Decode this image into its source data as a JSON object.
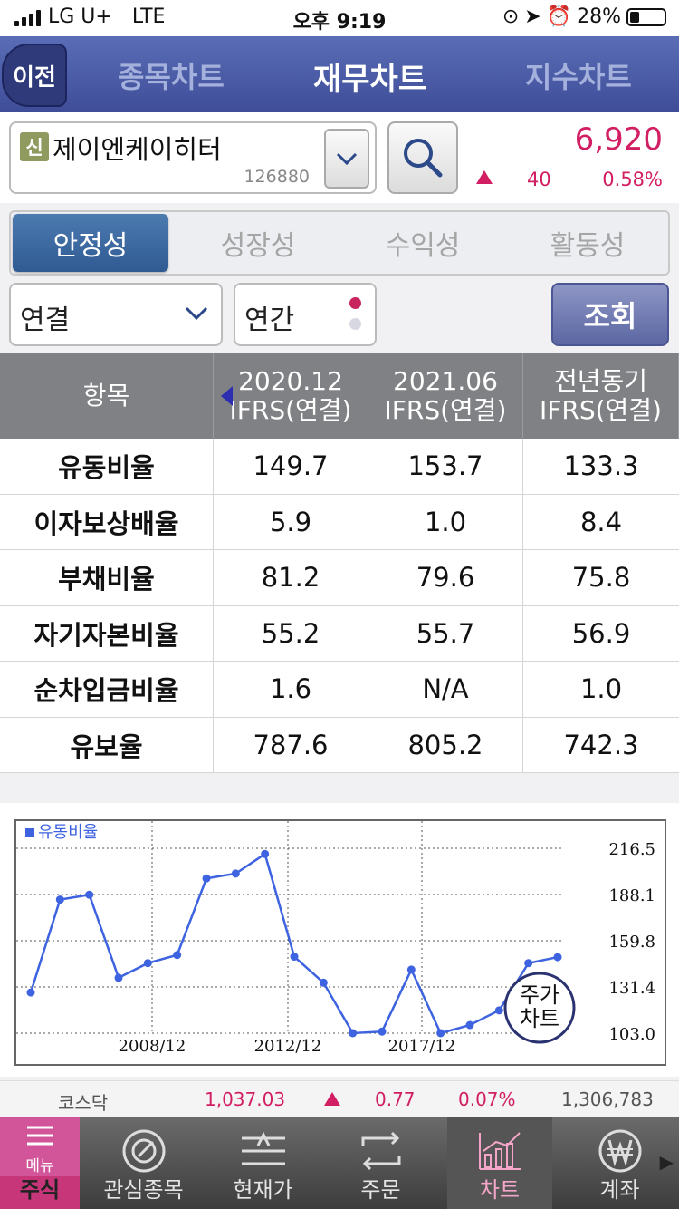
{
  "status_bar": {
    "carrier": "LG U+",
    "network": "LTE",
    "time": "오후 9:19",
    "battery": "28%"
  },
  "header": {
    "back_label": "이전",
    "tabs": [
      "종목차트",
      "재무차트",
      "지수차트"
    ],
    "active_tab": "재무차트"
  },
  "stock": {
    "badge": "신",
    "name": "제이엔케이히터",
    "code": "126880",
    "price": "6,920",
    "change": "40",
    "change_pct": "0.58%",
    "direction": "up",
    "up_color": "#d21e63"
  },
  "segments": {
    "items": [
      "안정성",
      "성장성",
      "수익성",
      "활동성"
    ],
    "active": "안정성"
  },
  "filters": {
    "consolidation": "연결",
    "period": "연간",
    "query_label": "조회"
  },
  "table": {
    "header_label": "항목",
    "columns": [
      {
        "line1": "2020.12",
        "line2": "IFRS(연결)"
      },
      {
        "line1": "2021.06",
        "line2": "IFRS(연결)"
      },
      {
        "line1": "전년동기",
        "line2": "IFRS(연결)"
      }
    ],
    "rows": [
      {
        "label": "유동비율",
        "values": [
          "149.7",
          "153.7",
          "133.3"
        ]
      },
      {
        "label": "이자보상배율",
        "values": [
          "5.9",
          "1.0",
          "8.4"
        ]
      },
      {
        "label": "부채비율",
        "values": [
          "81.2",
          "79.6",
          "75.8"
        ]
      },
      {
        "label": "자기자본비율",
        "values": [
          "55.2",
          "55.7",
          "56.9"
        ]
      },
      {
        "label": "순차입금비율",
        "values": [
          "1.6",
          "N/A",
          "1.0"
        ]
      },
      {
        "label": "유보율",
        "values": [
          "787.6",
          "805.2",
          "742.3"
        ]
      }
    ]
  },
  "chart_data": {
    "type": "line",
    "legend": "유동비율",
    "series": [
      {
        "name": "유동비율",
        "values": [
          128,
          185,
          188,
          137,
          146,
          151,
          198,
          201,
          213,
          150,
          134,
          103,
          104,
          142,
          103,
          108,
          117,
          146,
          149.7
        ]
      }
    ],
    "x_tick_labels": [
      "2008/12",
      "2012/12",
      "2017/12"
    ],
    "y_tick_labels": [
      "216.5",
      "188.1",
      "159.8",
      "131.4",
      "103.0"
    ],
    "ylim": [
      103.0,
      216.5
    ],
    "grid": true,
    "line_color": "#3d63e0",
    "stock_chart_button": {
      "line1": "주가",
      "line2": "차트"
    }
  },
  "ticker": {
    "index_name": "코스닥",
    "value": "1,037.03",
    "change": "0.77",
    "change_pct": "0.07%",
    "volume": "1,306,783"
  },
  "bottom_nav": {
    "menu_label": "메뉴",
    "items": [
      "주식",
      "관심종목",
      "현재가",
      "주문",
      "차트",
      "계좌"
    ],
    "active": "차트"
  }
}
